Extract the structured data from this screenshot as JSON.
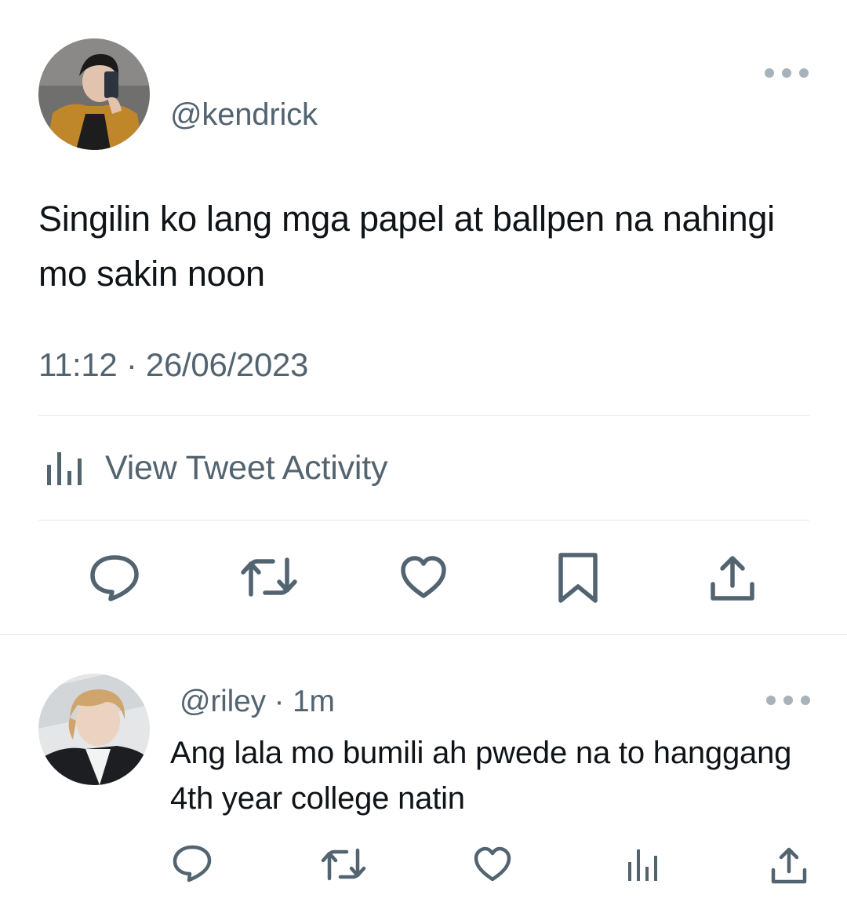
{
  "tweet": {
    "handle": "@kendrick",
    "text": "Singilin ko lang mga papel at ballpen na nahingi mo sakin noon",
    "timestamp": "11:12 · 26/06/2023",
    "activity_label": "View Tweet Activity",
    "actions": [
      "reply-icon",
      "retweet-icon",
      "like-icon",
      "bookmark-icon",
      "share-icon"
    ]
  },
  "reply": {
    "handle": "@riley",
    "separator": "·",
    "time": "1m",
    "text": "Ang lala mo bumili ah pwede na to hanggang 4th year college natin",
    "actions": [
      "reply-icon",
      "retweet-icon",
      "like-icon",
      "analytics-icon",
      "share-icon"
    ]
  },
  "colors": {
    "text": "#0f1419",
    "secondary": "#536471",
    "divider": "#e6e9eb"
  }
}
